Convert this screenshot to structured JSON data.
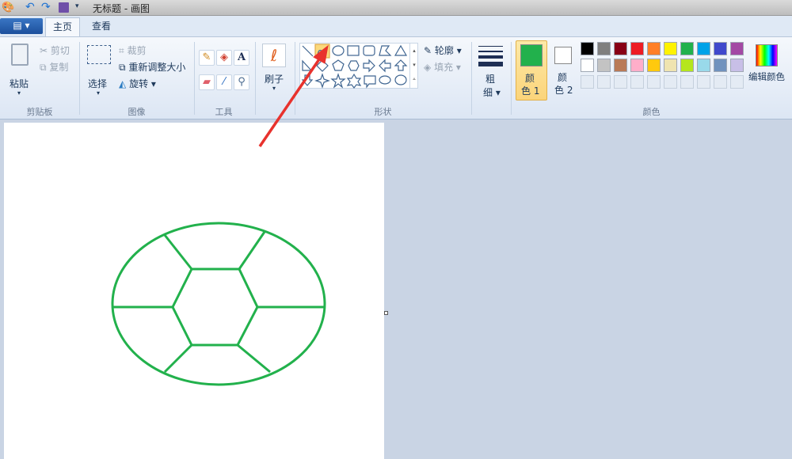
{
  "window": {
    "title": "无标题 - 画图"
  },
  "tabs": [
    {
      "label": "主页",
      "active": true
    },
    {
      "label": "查看",
      "active": false
    }
  ],
  "clipboard": {
    "paste": "粘贴",
    "cut": "剪切",
    "copy": "复制",
    "group": "剪贴板"
  },
  "image": {
    "select": "选择",
    "crop": "裁剪",
    "resize": "重新调整大小",
    "rotate": "旋转",
    "group": "图像"
  },
  "tools": {
    "group": "工具",
    "text_icon": "A"
  },
  "brush": {
    "label": "刷子"
  },
  "shapes": {
    "outline": "轮廓",
    "fill": "填充",
    "group": "形状",
    "selected": "curve"
  },
  "size": {
    "label1": "粗",
    "label2": "细"
  },
  "colors": {
    "color1": "颜色 1",
    "color1_a": "颜",
    "color1_b": "色 1",
    "color2_a": "颜",
    "color2_b": "色 2",
    "edit": "编辑颜色",
    "group": "颜色",
    "color1_value": "#22b14c",
    "color2_value": "#ffffff",
    "palette_row1": [
      "#000000",
      "#7f7f7f",
      "#880015",
      "#ed1c24",
      "#ff7f27",
      "#fff200",
      "#22b14c",
      "#00a2e8",
      "#3f48cc",
      "#a349a4"
    ],
    "palette_row2": [
      "#ffffff",
      "#c3c3c3",
      "#b97a57",
      "#ffaec9",
      "#ffc90e",
      "#efe4b0",
      "#b5e61d",
      "#99d9ea",
      "#7092be",
      "#c8bfe7"
    ]
  },
  "drawing": {
    "stroke": "#22b14c",
    "annotation_arrow": "#e8322d"
  }
}
